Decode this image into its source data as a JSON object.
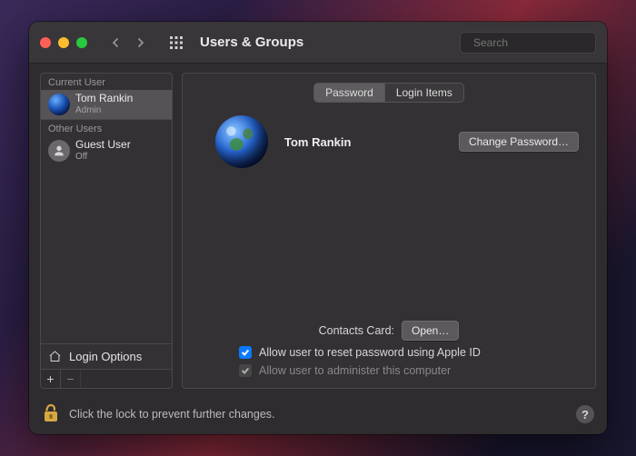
{
  "window": {
    "title": "Users & Groups"
  },
  "search": {
    "placeholder": "Search",
    "value": ""
  },
  "sidebar": {
    "current_header": "Current User",
    "other_header": "Other Users",
    "current": {
      "name": "Tom Rankin",
      "role": "Admin"
    },
    "others": [
      {
        "name": "Guest User",
        "role": "Off"
      }
    ],
    "login_options": "Login Options"
  },
  "tabs": {
    "password": "Password",
    "login_items": "Login Items"
  },
  "profile": {
    "name": "Tom Rankin",
    "change_password": "Change Password…"
  },
  "contacts": {
    "label": "Contacts Card:",
    "open": "Open…"
  },
  "checkboxes": {
    "reset_appleid": "Allow user to reset password using Apple ID",
    "administer": "Allow user to administer this computer"
  },
  "footer": {
    "text": "Click the lock to prevent further changes."
  },
  "help": "?"
}
